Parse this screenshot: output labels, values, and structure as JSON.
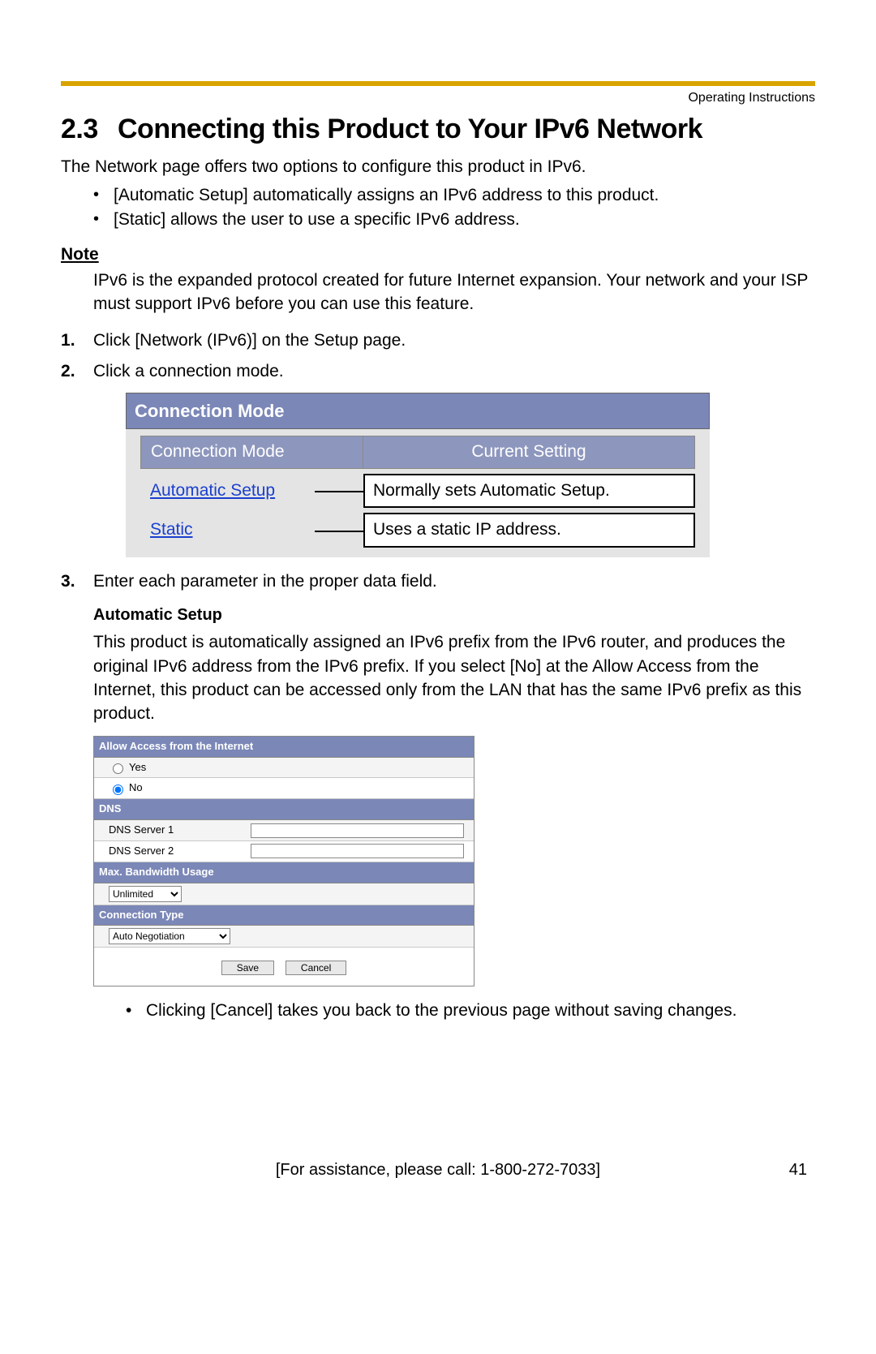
{
  "header": {
    "label": "Operating Instructions"
  },
  "title": {
    "number": "2.3",
    "text": "Connecting this Product to Your IPv6 Network"
  },
  "intro": "The Network page offers two options to configure this product in IPv6.",
  "intro_bullets": [
    "[Automatic Setup] automatically assigns an IPv6 address to this product.",
    "[Static] allows the user to use a specific IPv6 address."
  ],
  "note": {
    "heading": "Note",
    "body": "IPv6 is the expanded protocol created for future Internet expansion. Your network and your ISP must support IPv6 before you can use this feature."
  },
  "steps": {
    "s1": "Click [Network (IPv6)] on the Setup page.",
    "s2": "Click a connection mode.",
    "s3": "Enter each parameter in the proper data field."
  },
  "connection_mode_fig": {
    "title": "Connection Mode",
    "header_left": "Connection Mode",
    "header_right": "Current Setting",
    "rows": [
      {
        "link": "Automatic Setup",
        "callout": "Normally sets Automatic Setup."
      },
      {
        "link": "Static",
        "callout": "Uses a static IP address."
      }
    ]
  },
  "auto_setup": {
    "heading": "Automatic Setup",
    "para": "This product is automatically assigned an IPv6 prefix from the IPv6 router, and produces the original IPv6 address from the IPv6 prefix. If you select [No] at the Allow Access from the Internet, this product can be accessed only from the LAN that has the same IPv6 prefix as this product."
  },
  "settings_panel": {
    "sections": {
      "access": {
        "title": "Allow Access from the Internet",
        "yes": "Yes",
        "no": "No",
        "selected": "No"
      },
      "dns": {
        "title": "DNS",
        "server1_label": "DNS Server 1",
        "server1_value": "",
        "server2_label": "DNS Server 2",
        "server2_value": ""
      },
      "bandwidth": {
        "title": "Max. Bandwidth Usage",
        "value": "Unlimited"
      },
      "conn_type": {
        "title": "Connection Type",
        "value": "Auto Negotiation"
      }
    },
    "buttons": {
      "save": "Save",
      "cancel": "Cancel"
    }
  },
  "post_bullet": "Clicking [Cancel] takes you back to the previous page without saving changes.",
  "footer": {
    "assist": "[For assistance, please call: 1-800-272-7033]",
    "page": "41"
  }
}
